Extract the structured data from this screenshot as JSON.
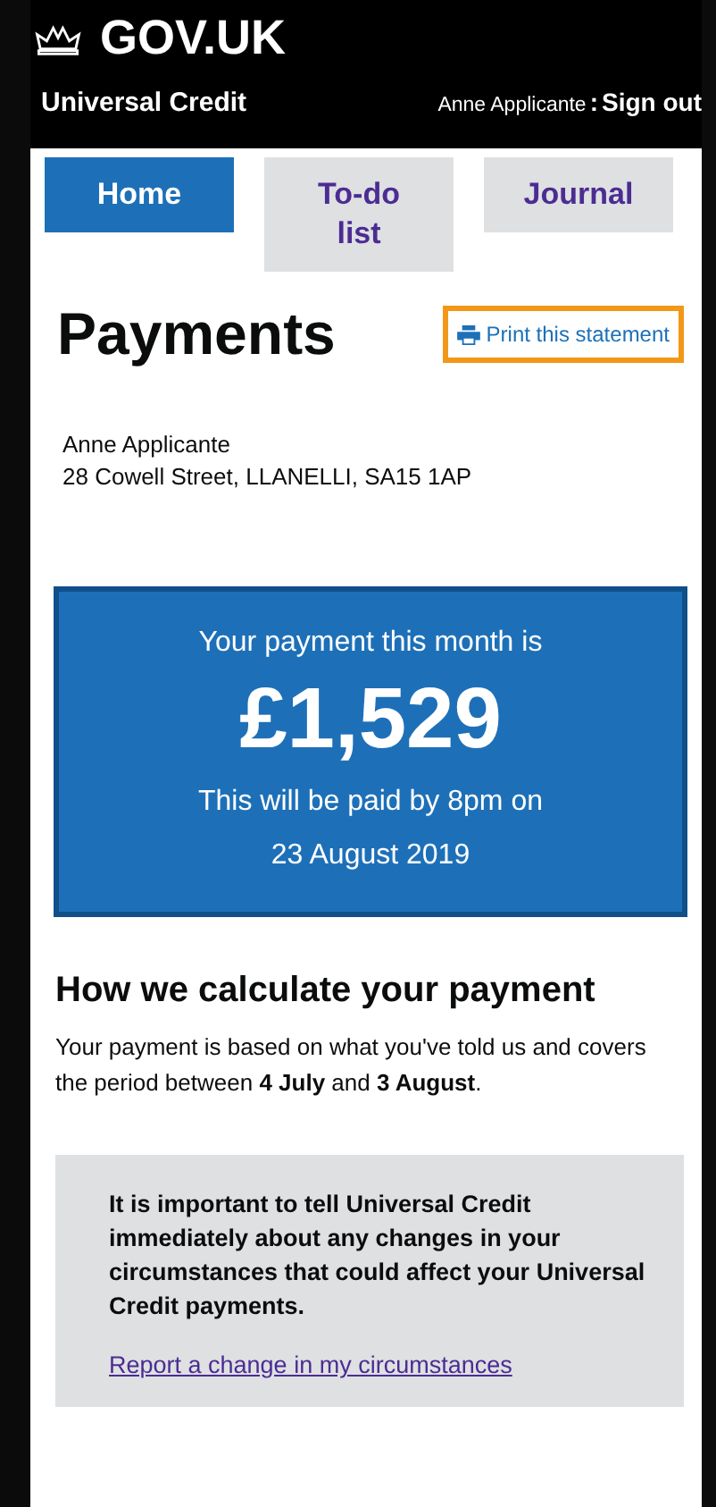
{
  "header": {
    "logo": "GOV.UK",
    "service": "Universal Credit",
    "user": "Anne Applicante",
    "separator": ":",
    "sign_out": "Sign out"
  },
  "tabs": [
    {
      "label": "Home",
      "selected": true
    },
    {
      "label": "To-do list",
      "selected": false
    },
    {
      "label": "Journal",
      "selected": false
    }
  ],
  "page": {
    "title": "Payments",
    "print_link": "Print this statement",
    "name": "Anne Applicante",
    "address": "28 Cowell Street, LLANELLI, SA15 1AP"
  },
  "payment": {
    "intro": "Your payment this month is",
    "amount": "£1,529",
    "when": "This will be paid by 8pm on",
    "date": "23 August 2019"
  },
  "calculation": {
    "heading": "How we calculate your payment",
    "text": "Your payment is based on what you've told us and covers the period between **4 July** and **3 August**."
  },
  "notice": {
    "text": "It is important to tell Universal Credit immediately about any changes in your circumstances that could affect your Universal Credit payments.",
    "link": "Report a change in my circumstances"
  }
}
